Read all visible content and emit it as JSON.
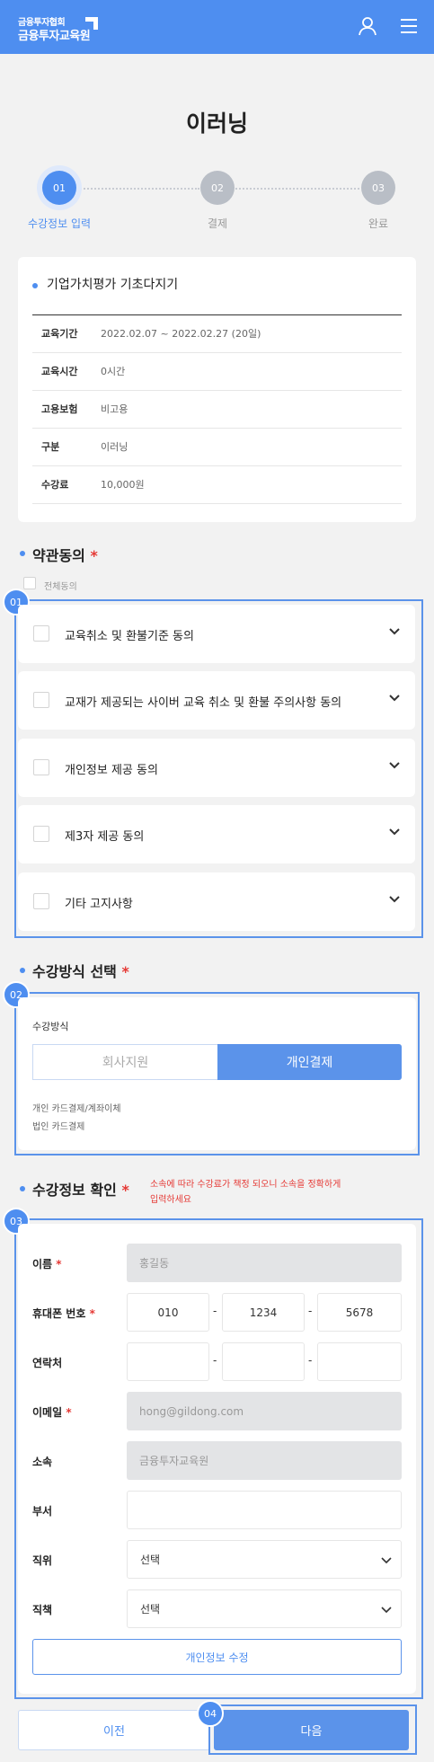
{
  "header": {
    "logo_line1": "금융투자협회",
    "logo_line2": "금융투자교육원",
    "colors": {
      "brand": "#4e8ef0"
    }
  },
  "page_title": "이러닝",
  "steps": [
    {
      "num": "01",
      "label": "수강정보 입력",
      "active": true
    },
    {
      "num": "02",
      "label": "결제",
      "active": false
    },
    {
      "num": "03",
      "label": "완료",
      "active": false
    }
  ],
  "course": {
    "title": "기업가치평가 기초다지기",
    "rows": [
      {
        "label": "교육기간",
        "value": "2022.02.07 ~ 2022.02.27 (20일)"
      },
      {
        "label": "교육시간",
        "value": "0시간"
      },
      {
        "label": "고용보험",
        "value": "비고용"
      },
      {
        "label": "구분",
        "value": "이러닝"
      },
      {
        "label": "수강료",
        "value": "10,000원"
      }
    ]
  },
  "terms": {
    "title": "약관동의",
    "required_mark": "*",
    "agree_all": "전체동의",
    "badge": "01",
    "items": [
      {
        "label": "교육취소 및 환불기준 동의"
      },
      {
        "label": "교재가 제공되는 사이버 교육 취소 및 환불 주의사항 동의"
      },
      {
        "label": "개인정보 제공 동의"
      },
      {
        "label": "제3자 제공 동의"
      },
      {
        "label": "기타 고지사항"
      }
    ]
  },
  "method": {
    "title": "수강방식 선택",
    "required_mark": "*",
    "badge": "02",
    "field_label": "수강방식",
    "options": [
      "회사지원",
      "개인결제"
    ],
    "selected": "개인결제",
    "desc1": "개인 카드결제/계좌이체",
    "desc2": "법인 카드결제"
  },
  "info": {
    "title": "수강정보 확인",
    "required_mark": "*",
    "badge": "03",
    "notice_line1": "소속에 따라 수강료가 책정 되오니 소속을 정확하게",
    "notice_line2": "입력하세요",
    "name": {
      "label": "이름",
      "value": "홍길동"
    },
    "mobile": {
      "label": "휴대폰 번호",
      "p1": "010",
      "p2": "1234",
      "p3": "5678"
    },
    "contact": {
      "label": "연락처",
      "p1": "",
      "p2": "",
      "p3": ""
    },
    "email": {
      "label": "이메일",
      "value": "hong@gildong.com"
    },
    "affiliation": {
      "label": "소속",
      "value": "금융투자교육원"
    },
    "department": {
      "label": "부서",
      "value": ""
    },
    "position": {
      "label": "직위",
      "value": "선택"
    },
    "duty": {
      "label": "직책",
      "value": "선택"
    },
    "edit_button": "개인정보 수정",
    "dash": "-"
  },
  "footer": {
    "prev": "이전",
    "next": "다음",
    "badge": "04"
  }
}
